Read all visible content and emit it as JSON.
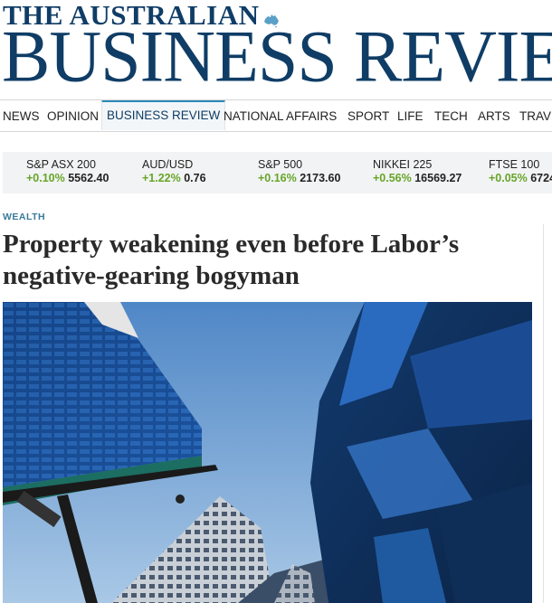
{
  "masthead": {
    "top_line": "THE AUSTRALIAN",
    "main_line": "BUSINESS REVIEW",
    "brand_color": "#0f3d66"
  },
  "nav": {
    "items": [
      {
        "label": "NEWS"
      },
      {
        "label": "OPINION"
      },
      {
        "label": "BUSINESS REVIEW",
        "active": true
      },
      {
        "label": "NATIONAL AFFAIRS"
      },
      {
        "label": "SPORT"
      },
      {
        "label": "LIFE"
      },
      {
        "label": "TECH"
      },
      {
        "label": "ARTS"
      },
      {
        "label": "TRAVEL"
      }
    ],
    "accent_color": "#2a8ab9"
  },
  "ticker": {
    "items": [
      {
        "name": "S&P ASX 200",
        "change": "+0.10%",
        "value": "5562.40"
      },
      {
        "name": "AUD/USD",
        "change": "+1.22%",
        "value": "0.76"
      },
      {
        "name": "S&P 500",
        "change": "+0.16%",
        "value": "2173.60"
      },
      {
        "name": "NIKKEI 225",
        "change": "+0.56%",
        "value": "16569.27"
      },
      {
        "name": "FTSE 100",
        "change": "+0.05%",
        "value": "6724"
      }
    ],
    "positive_color": "#66a528"
  },
  "article": {
    "section": "WEALTH",
    "headline": "Property weakening even before Labor’s negative-gearing bogyman",
    "hero_image": "city-towers-looking-up"
  }
}
